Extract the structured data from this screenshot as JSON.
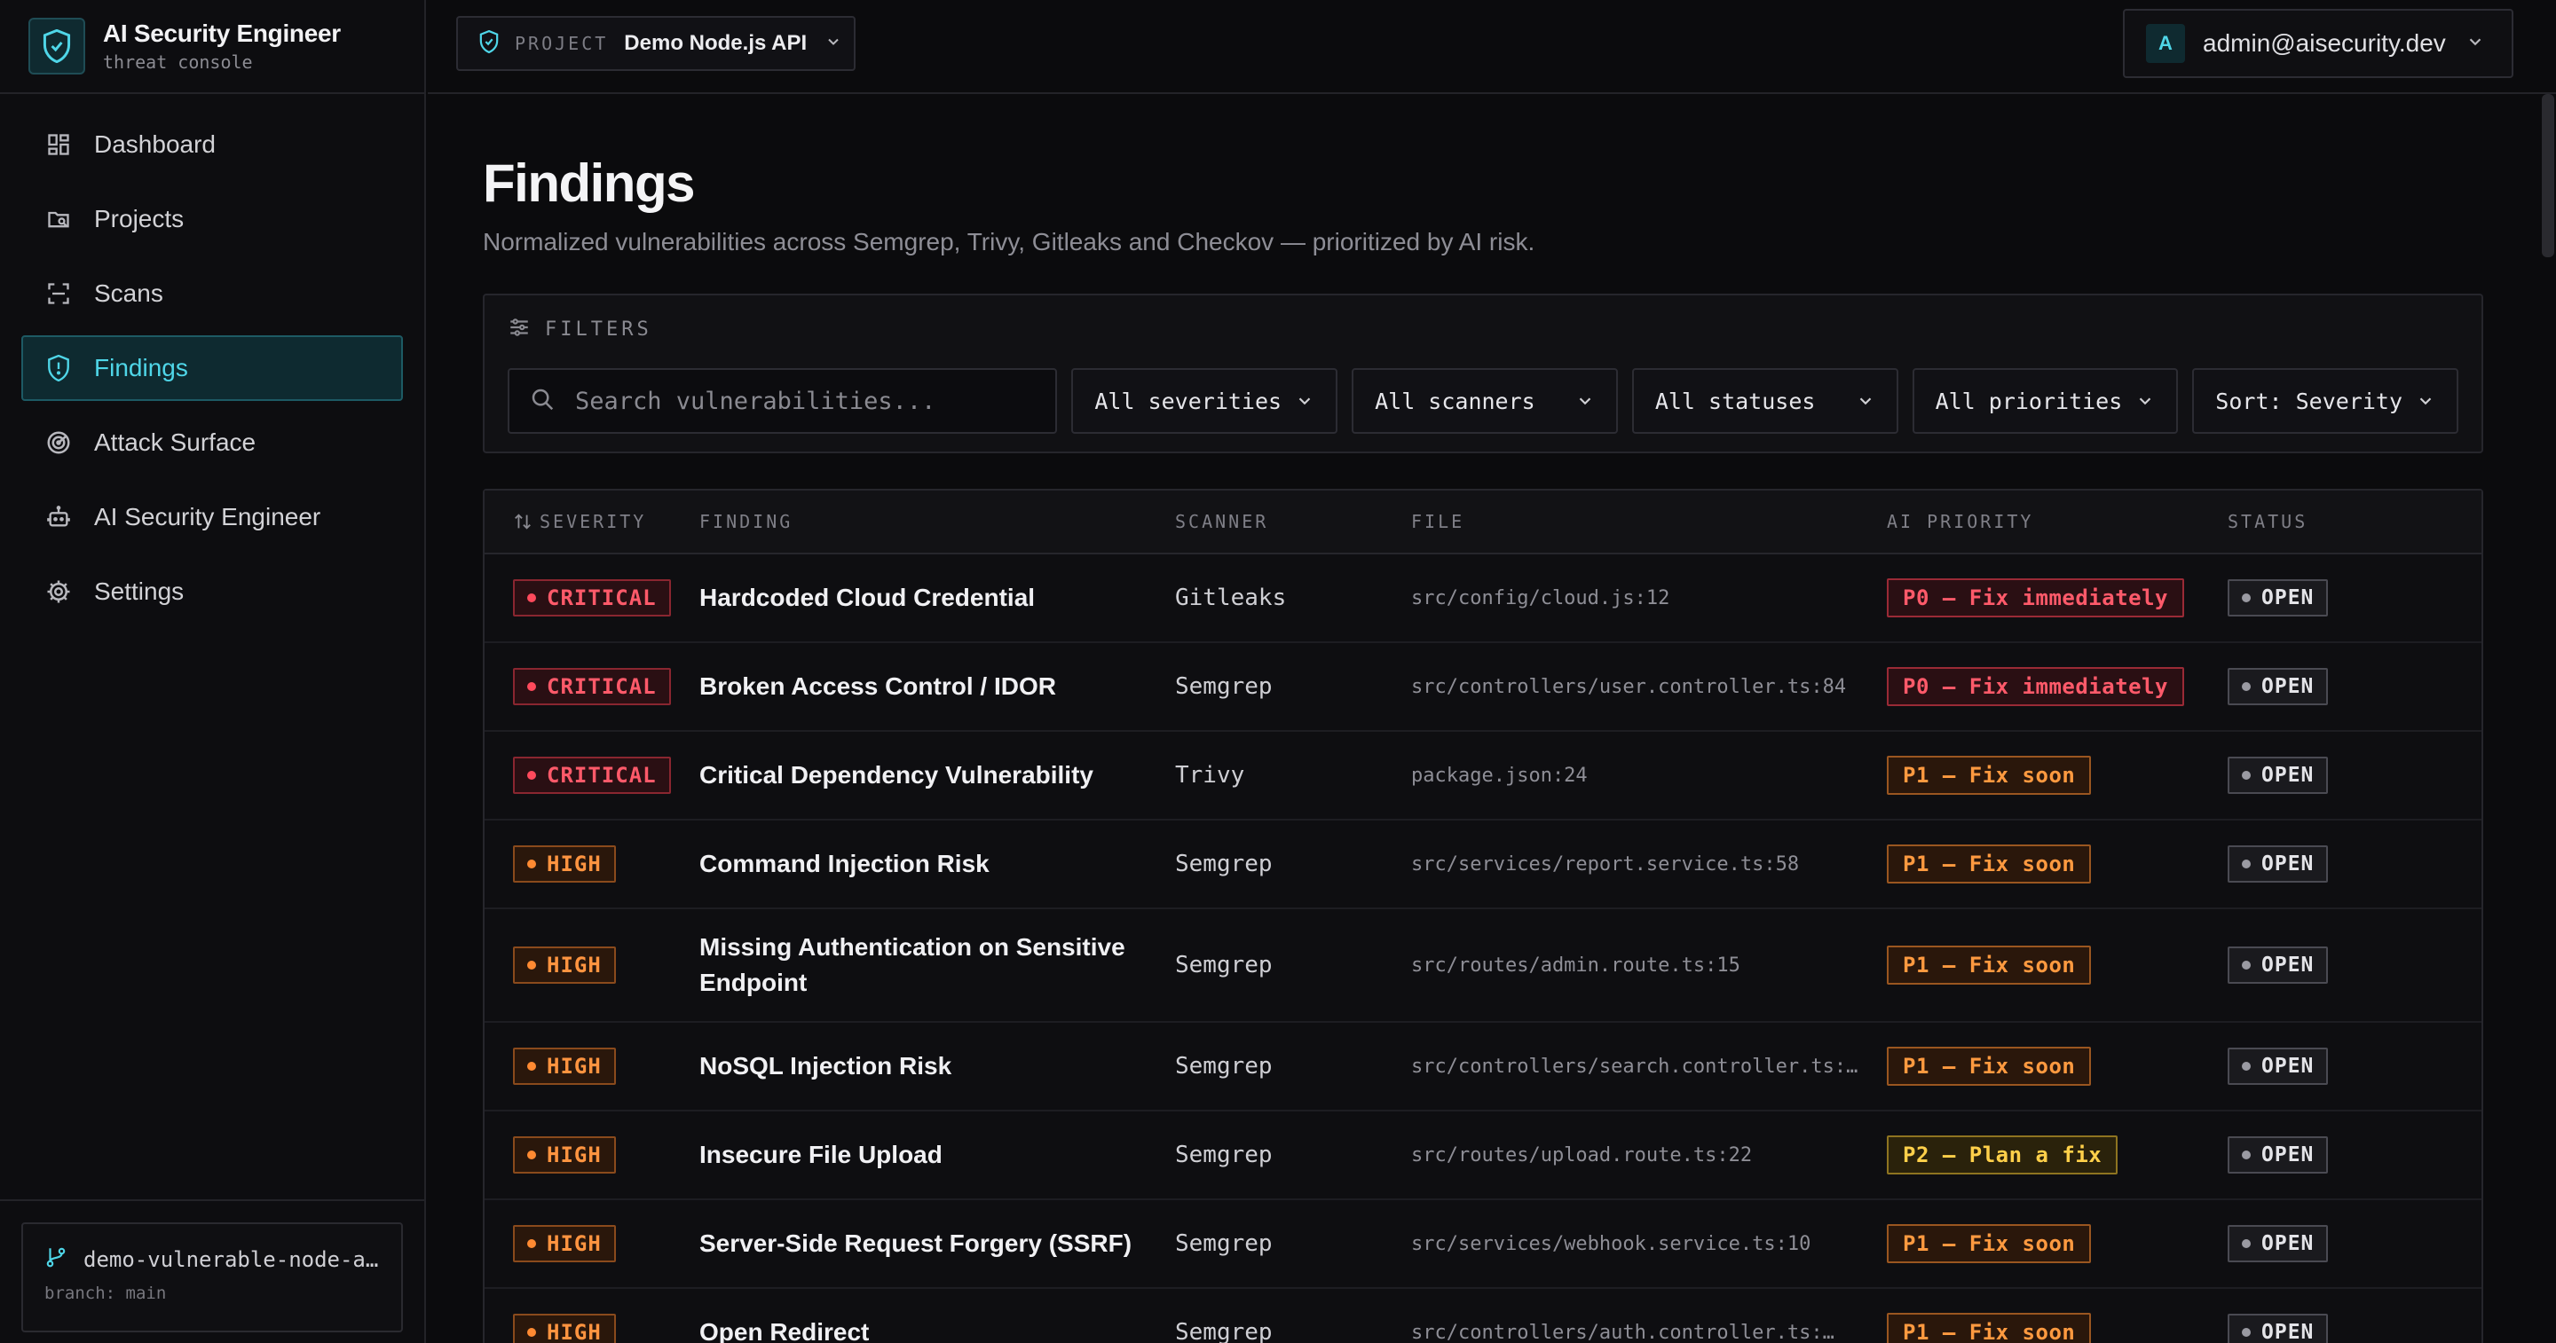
{
  "brand": {
    "title": "AI Security Engineer",
    "subtitle": "threat console"
  },
  "sidebar": {
    "items": [
      {
        "label": "Dashboard",
        "icon": "dashboard-grid-icon",
        "active": false
      },
      {
        "label": "Projects",
        "icon": "folder-icon",
        "active": false
      },
      {
        "label": "Scans",
        "icon": "scan-icon",
        "active": false
      },
      {
        "label": "Findings",
        "icon": "shield-icon",
        "active": true
      },
      {
        "label": "Attack Surface",
        "icon": "radar-icon",
        "active": false
      },
      {
        "label": "AI Security Engineer",
        "icon": "robot-icon",
        "active": false
      },
      {
        "label": "Settings",
        "icon": "gear-icon",
        "active": false
      }
    ],
    "repo": {
      "name": "demo-vulnerable-node-a…",
      "branch": "branch: main"
    }
  },
  "topbar": {
    "project_tag": "PROJECT",
    "project_name": "Demo Node.js API",
    "user_initial": "A",
    "user_email": "admin@aisecurity.dev"
  },
  "page": {
    "title": "Findings",
    "subtitle": "Normalized vulnerabilities across Semgrep, Trivy, Gitleaks and Checkov — prioritized by AI risk."
  },
  "filters": {
    "title": "FILTERS",
    "search_placeholder": "Search vulnerabilities...",
    "severity": "All severities",
    "scanner": "All scanners",
    "status": "All statuses",
    "priority": "All priorities",
    "sort": "Sort: Severity"
  },
  "table": {
    "headers": {
      "severity": "SEVERITY",
      "finding": "FINDING",
      "scanner": "SCANNER",
      "file": "FILE",
      "priority": "AI PRIORITY",
      "status": "STATUS"
    },
    "rows": [
      {
        "severity": "CRITICAL",
        "sev_class": "critical",
        "finding": "Hardcoded Cloud Credential",
        "scanner": "Gitleaks",
        "file": "src/config/cloud.js:12",
        "priority": "P0 — Fix immediately",
        "pri_class": "p0",
        "status": "OPEN"
      },
      {
        "severity": "CRITICAL",
        "sev_class": "critical",
        "finding": "Broken Access Control / IDOR",
        "scanner": "Semgrep",
        "file": "src/controllers/user.controller.ts:84",
        "priority": "P0 — Fix immediately",
        "pri_class": "p0",
        "status": "OPEN"
      },
      {
        "severity": "CRITICAL",
        "sev_class": "critical",
        "finding": "Critical Dependency Vulnerability",
        "scanner": "Trivy",
        "file": "package.json:24",
        "priority": "P1 — Fix soon",
        "pri_class": "p1",
        "status": "OPEN"
      },
      {
        "severity": "HIGH",
        "sev_class": "high",
        "finding": "Command Injection Risk",
        "scanner": "Semgrep",
        "file": "src/services/report.service.ts:58",
        "priority": "P1 — Fix soon",
        "pri_class": "p1",
        "status": "OPEN"
      },
      {
        "severity": "HIGH",
        "sev_class": "high",
        "finding": "Missing Authentication on Sensitive Endpoint",
        "scanner": "Semgrep",
        "file": "src/routes/admin.route.ts:15",
        "priority": "P1 — Fix soon",
        "pri_class": "p1",
        "status": "OPEN"
      },
      {
        "severity": "HIGH",
        "sev_class": "high",
        "finding": "NoSQL Injection Risk",
        "scanner": "Semgrep",
        "file": "src/controllers/search.controller.ts:…",
        "priority": "P1 — Fix soon",
        "pri_class": "p1",
        "status": "OPEN"
      },
      {
        "severity": "HIGH",
        "sev_class": "high",
        "finding": "Insecure File Upload",
        "scanner": "Semgrep",
        "file": "src/routes/upload.route.ts:22",
        "priority": "P2 — Plan a fix",
        "pri_class": "p2",
        "status": "OPEN"
      },
      {
        "severity": "HIGH",
        "sev_class": "high",
        "finding": "Server-Side Request Forgery (SSRF)",
        "scanner": "Semgrep",
        "file": "src/services/webhook.service.ts:10",
        "priority": "P1 — Fix soon",
        "pri_class": "p1",
        "status": "OPEN"
      },
      {
        "severity": "HIGH",
        "sev_class": "high",
        "finding": "Open Redirect",
        "scanner": "Semgrep",
        "file": "src/controllers/auth.controller.ts:…",
        "priority": "P1 — Fix soon",
        "pri_class": "p1",
        "status": "OPEN"
      }
    ]
  },
  "colors": {
    "accent": "#4fd6e8",
    "critical": "#ff5a6a",
    "high": "#ff9440",
    "p2": "#ffd04a",
    "background": "#0b0b0d"
  }
}
